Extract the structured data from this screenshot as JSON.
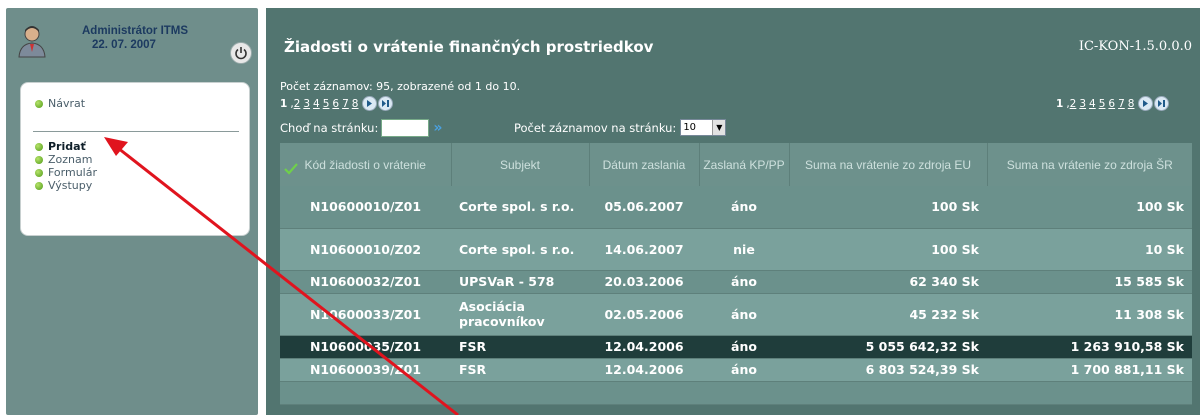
{
  "user": {
    "name": "Administrátor ITMS",
    "date": "22. 07. 2007"
  },
  "menu": {
    "back": "Návrat",
    "items": [
      "Pridať",
      "Zoznam",
      "Formulár",
      "Výstupy"
    ]
  },
  "header": {
    "title": "Žiadosti o vrátenie finančných prostriedkov",
    "code": "IC-KON-1.5.0.0.0"
  },
  "record_info": "Počet záznamov: 95, zobrazené od 1 do 10.",
  "pager": {
    "pages": [
      "1",
      "2",
      "3",
      "4",
      "5",
      "6",
      "7",
      "8"
    ],
    "current": "1"
  },
  "goto_label": "Choď na stránku:",
  "per_page_label": "Počet záznamov na stránku:",
  "per_page_value": "10",
  "table": {
    "headers": [
      "Kód žiadosti o vrátenie",
      "Subjekt",
      "Dátum zaslania",
      "Zaslaná KP/PP",
      "Suma na vrátenie zo zdroja EU",
      "Suma na vrátenie zo zdroja ŠR"
    ],
    "rows": [
      {
        "code": "N10600010/Z01",
        "subject": "Corte spol. s r.o.",
        "date": "05.06.2007",
        "sent": "áno",
        "eu": "100 Sk",
        "sr": "100 Sk"
      },
      {
        "code": "N10600010/Z02",
        "subject": "Corte spol. s r.o.",
        "date": "14.06.2007",
        "sent": "nie",
        "eu": "100 Sk",
        "sr": "10 Sk"
      },
      {
        "code": "N10600032/Z01",
        "subject": "UPSVaR - 578",
        "date": "20.03.2006",
        "sent": "áno",
        "eu": "62 340 Sk",
        "sr": "15 585 Sk"
      },
      {
        "code": "N10600033/Z01",
        "subject": "Asociácia pracovníkov",
        "date": "02.05.2006",
        "sent": "áno",
        "eu": "45 232 Sk",
        "sr": "11 308 Sk"
      },
      {
        "code": "N10600035/Z01",
        "subject": "FSR",
        "date": "12.04.2006",
        "sent": "áno",
        "eu": "5 055 642,32 Sk",
        "sr": "1 263 910,58 Sk"
      },
      {
        "code": "N10600039/Z01",
        "subject": "FSR",
        "date": "12.04.2006",
        "sent": "áno",
        "eu": "6 803 524,39 Sk",
        "sr": "1 700 881,11 Sk"
      }
    ]
  },
  "colors": {
    "panel": "#527570",
    "row_a": "#6b918c",
    "row_b": "#7aa19c",
    "row_selected": "#1f3d3b",
    "arrow": "#e0141e"
  }
}
